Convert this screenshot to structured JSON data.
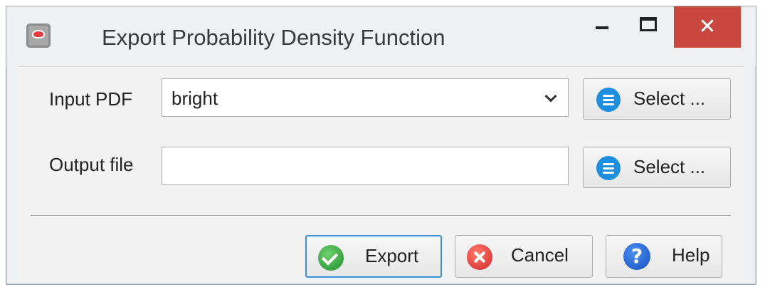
{
  "window": {
    "title": "Export Probability Density Function",
    "controls": {
      "minimize_icon": "minimize-icon",
      "maximize_icon": "maximize-icon",
      "close_icon": "close-icon",
      "close_glyph": "✕"
    }
  },
  "form": {
    "input_pdf_label": "Input PDF",
    "input_pdf_value": "bright",
    "output_file_label": "Output file",
    "output_file_value": "",
    "select_label": "Select ..."
  },
  "actions": {
    "export_label": "Export",
    "cancel_label": "Cancel",
    "help_label": "Help",
    "help_glyph": "?"
  },
  "colors": {
    "close_button": "#c9473f",
    "select_icon": "#1e8fe0",
    "export_icon": "#2f9f3f",
    "cancel_icon": "#d3272b",
    "help_icon": "#1d5fd0",
    "default_button_border": "#3c8fd6"
  }
}
